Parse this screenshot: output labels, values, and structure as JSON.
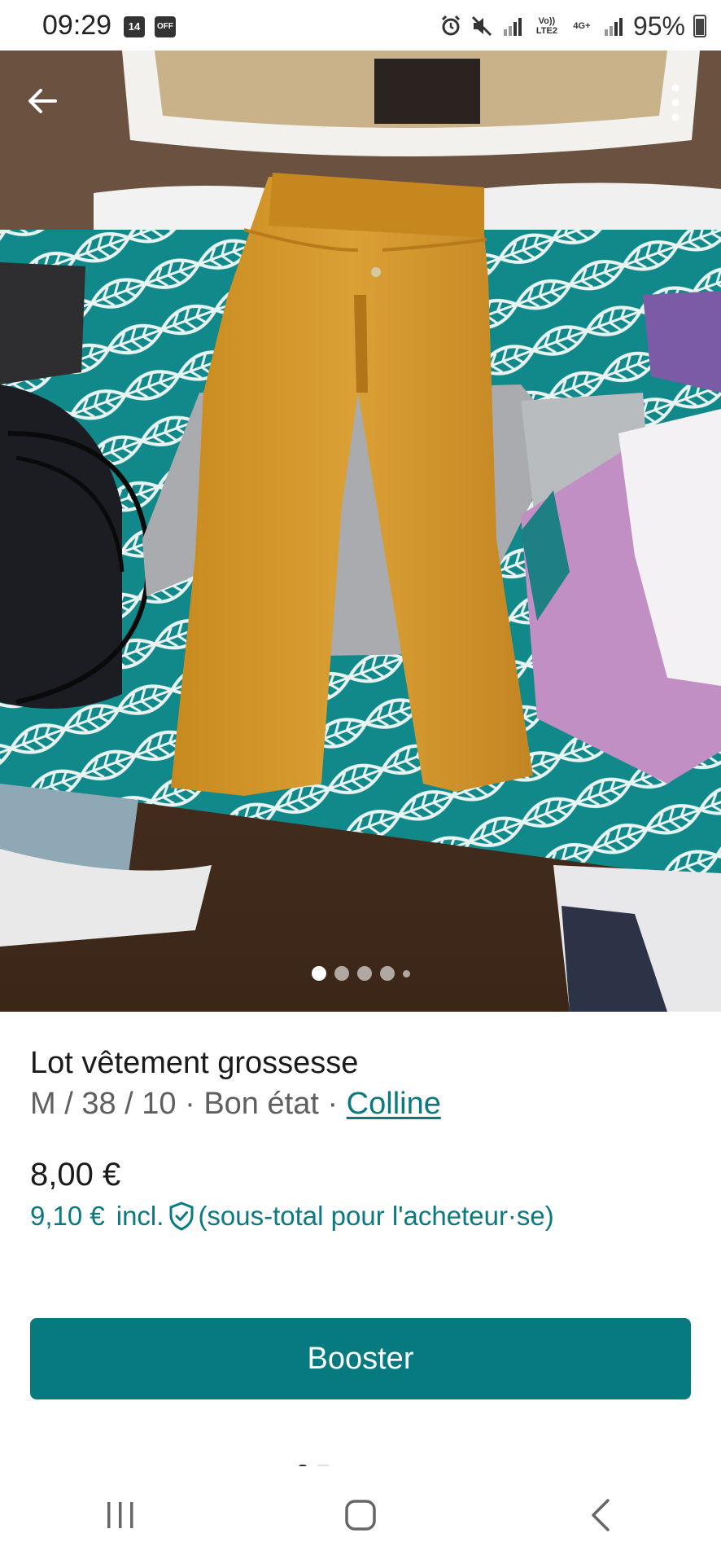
{
  "status_bar": {
    "time": "09:29",
    "notification_badges": [
      "14",
      "OFF"
    ],
    "network_label_1": "Vo)) LTE2",
    "network_label_2": "4G+",
    "battery": "95%"
  },
  "photo": {
    "pager": {
      "count": 5,
      "active_index": 0
    }
  },
  "listing": {
    "title": "Lot vêtement grossesse",
    "size": "M / 38 / 10",
    "separator": " · ",
    "condition": "Bon état",
    "brand": "Colline",
    "price": "8,00 €",
    "total_price": "9,10 €",
    "total_incl": "incl.",
    "total_note": "(sous-total pour l'acheteur·se)"
  },
  "actions": {
    "booster_label": "Booster"
  },
  "colors": {
    "accent": "#077a80",
    "link": "#0b7a80",
    "secondary_text": "#5f5f5f"
  }
}
